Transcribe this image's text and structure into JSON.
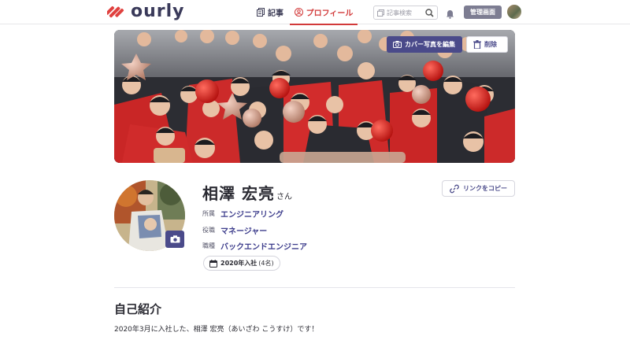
{
  "header": {
    "logo_text": "ourly",
    "nav": {
      "articles": "記事",
      "profile": "プロフィール"
    },
    "search_placeholder": "記事検索",
    "admin_label": "管理画面"
  },
  "cover": {
    "edit_label": "カバー写真を編集",
    "delete_label": "削除"
  },
  "profile": {
    "name": "相澤 宏亮",
    "honorific": "さん",
    "copy_link_label": "リンクをコピー",
    "fields": [
      {
        "key": "所属",
        "value": "エンジニアリング"
      },
      {
        "key": "役職",
        "value": "マネージャー"
      },
      {
        "key": "職種",
        "value": "バックエンドエンジニア"
      }
    ],
    "joined": {
      "label": "2020年入社",
      "count": "(4名)"
    }
  },
  "intro": {
    "title": "自己紹介",
    "text": "2020年3月に入社した、相澤 宏亮（あいざわ こうすけ）です！"
  },
  "colors": {
    "accent": "#4a4a8a",
    "brand_red": "#d23a3a",
    "link": "#3d3d8c"
  },
  "icons": [
    "logo-mark-icon",
    "articles-icon",
    "profile-icon",
    "search-icon",
    "bell-icon",
    "camera-icon",
    "trash-icon",
    "link-icon",
    "calendar-icon"
  ]
}
